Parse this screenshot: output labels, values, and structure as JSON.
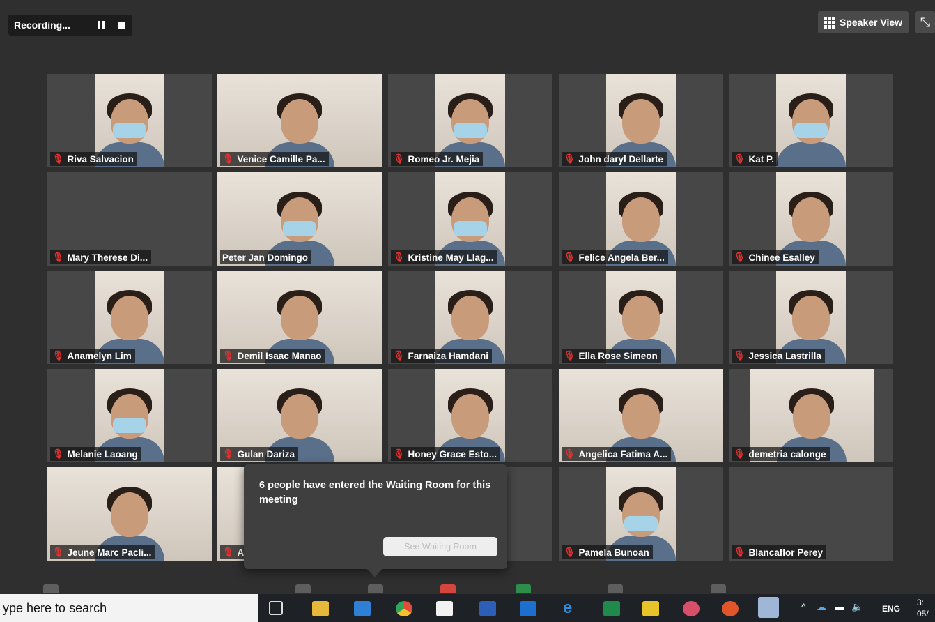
{
  "recording": {
    "label": "Recording..."
  },
  "view": {
    "speaker_view_label": "Speaker View"
  },
  "participants": [
    {
      "name": "Riva Salvacion",
      "muted": true,
      "video": true,
      "mask": true
    },
    {
      "name": "Venice Camille Pa...",
      "muted": true,
      "video": true,
      "mask": false
    },
    {
      "name": "Romeo Jr. Mejia",
      "muted": true,
      "video": true,
      "mask": true
    },
    {
      "name": "John daryl Dellarte",
      "muted": true,
      "video": true,
      "mask": false
    },
    {
      "name": "Kat P.",
      "muted": true,
      "video": true,
      "mask": true
    },
    {
      "name": "Mary Therese Di...",
      "muted": true,
      "video": false,
      "mask": false
    },
    {
      "name": "Peter Jan Domingo",
      "muted": false,
      "video": true,
      "mask": true
    },
    {
      "name": "Kristine May Llag...",
      "muted": true,
      "video": true,
      "mask": true
    },
    {
      "name": "Felice Angela Ber...",
      "muted": true,
      "video": true,
      "mask": false
    },
    {
      "name": "Chinee Esalley",
      "muted": true,
      "video": true,
      "mask": false
    },
    {
      "name": "Anamelyn Lim",
      "muted": true,
      "video": true,
      "mask": false
    },
    {
      "name": "Demil Isaac Manao",
      "muted": true,
      "video": true,
      "mask": false
    },
    {
      "name": "Farnaiza Hamdani",
      "muted": true,
      "video": true,
      "mask": false
    },
    {
      "name": "Ella Rose Simeon",
      "muted": true,
      "video": true,
      "mask": false
    },
    {
      "name": "Jessica Lastrilla",
      "muted": true,
      "video": true,
      "mask": false
    },
    {
      "name": "Melanie Laoang",
      "muted": true,
      "video": true,
      "mask": true
    },
    {
      "name": "Gulan Dariza",
      "muted": true,
      "video": true,
      "mask": false
    },
    {
      "name": "Honey Grace Esto...",
      "muted": true,
      "video": true,
      "mask": false
    },
    {
      "name": "Angelica Fatima A...",
      "muted": true,
      "video": true,
      "mask": false
    },
    {
      "name": "demetria calonge",
      "muted": true,
      "video": true,
      "mask": false
    },
    {
      "name": "Jeune Marc Pacli...",
      "muted": true,
      "video": true,
      "mask": false
    },
    {
      "name": "A",
      "muted": true,
      "video": true,
      "mask": false
    },
    {
      "name": "",
      "muted": false,
      "video": false,
      "mask": false
    },
    {
      "name": "Pamela Bunoan",
      "muted": true,
      "video": true,
      "mask": true
    },
    {
      "name": "Blancaflor Perey",
      "muted": true,
      "video": false,
      "mask": false
    }
  ],
  "waiting_room": {
    "message": "6 people have entered the Waiting Room for this meeting",
    "button_label": "See Waiting Room"
  },
  "taskbar": {
    "search_placeholder": "ype here to search",
    "language": "ENG",
    "clock_time": "3:",
    "clock_date": "05/"
  },
  "colors": {
    "background": "#2f2f2f",
    "tile": "#474747",
    "mic_off": "#e5312f",
    "taskbar": "#1e2227"
  }
}
